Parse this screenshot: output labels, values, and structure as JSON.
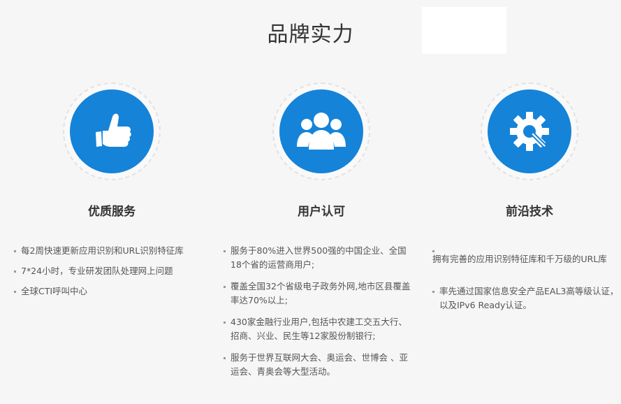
{
  "page": {
    "title": "品牌实力"
  },
  "features": [
    {
      "title": "优质服务",
      "icon": "thumbs-up-icon",
      "items": [
        "每2周快速更新应用识别和URL识别特征库",
        "7*24小时，专业研发团队处理网上问题",
        "全球CTI呼叫中心"
      ]
    },
    {
      "title": "用户认可",
      "icon": "users-group-icon",
      "items": [
        "服务于80%进入世界500强的中国企业、全国18个省的运营商用户;",
        "覆盖全国32个省级电子政务外网,地市区县覆盖率达70%以上;",
        "430家金融行业用户,包括中农建工交五大行、招商、兴业、民生等12家股份制银行;",
        "服务于世界互联网大会、奥运会、世博会 、亚运会、青奥会等大型活动。"
      ]
    },
    {
      "title": "前沿技术",
      "icon": "gear-wrench-icon",
      "items": [
        "拥有完善的应用识别特征库和千万级的URL库",
        "率先通过国家信息安全产品EAL3高等级认证，以及IPv6 Ready认证。"
      ]
    }
  ],
  "colors": {
    "accent": "#1583d8",
    "background": "#f6f6f6",
    "text": "#555555",
    "heading": "#333333"
  }
}
